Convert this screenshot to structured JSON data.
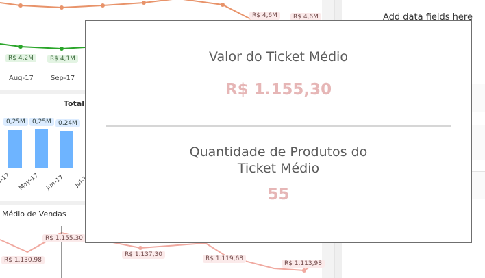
{
  "top_chart": {
    "x_labels": [
      "Aug-17",
      "Sep-17"
    ],
    "top_series_labels": [
      "R$ 4,6M",
      "R$ 4,6M"
    ],
    "bottom_series_labels": [
      "R$ 4,2M",
      "R$ 4,1M"
    ],
    "colors": {
      "top_line": "#e8936a",
      "bottom_line": "#2aa52a"
    }
  },
  "bar_chart": {
    "title_fragment": "Total",
    "x_labels": [
      "r-17",
      "May-17",
      "Jun-17",
      "Jul-1"
    ],
    "value_labels": [
      "0,25M",
      "0,25M",
      "0,24M"
    ],
    "bar_color": "#6eb4ff"
  },
  "line_chart": {
    "title_fragment": "Médio de Vendas",
    "point_labels": [
      "R$ 1.155,30",
      "R$ 1.130,98",
      "R$ 1.137,30",
      "R$ 1.119,68",
      "R$ 1.113,98"
    ],
    "line_color": "#f0a9a0"
  },
  "right_pane": {
    "hint": "Add data fields here"
  },
  "popup": {
    "ticket_title": "Valor do Ticket Médio",
    "ticket_value": "R$ 1.155,30",
    "qty_title_line1": "Quantidade de Produtos do",
    "qty_title_line2": "Ticket Médio",
    "qty_value": "55",
    "value_color": "#e6b6b6"
  }
}
